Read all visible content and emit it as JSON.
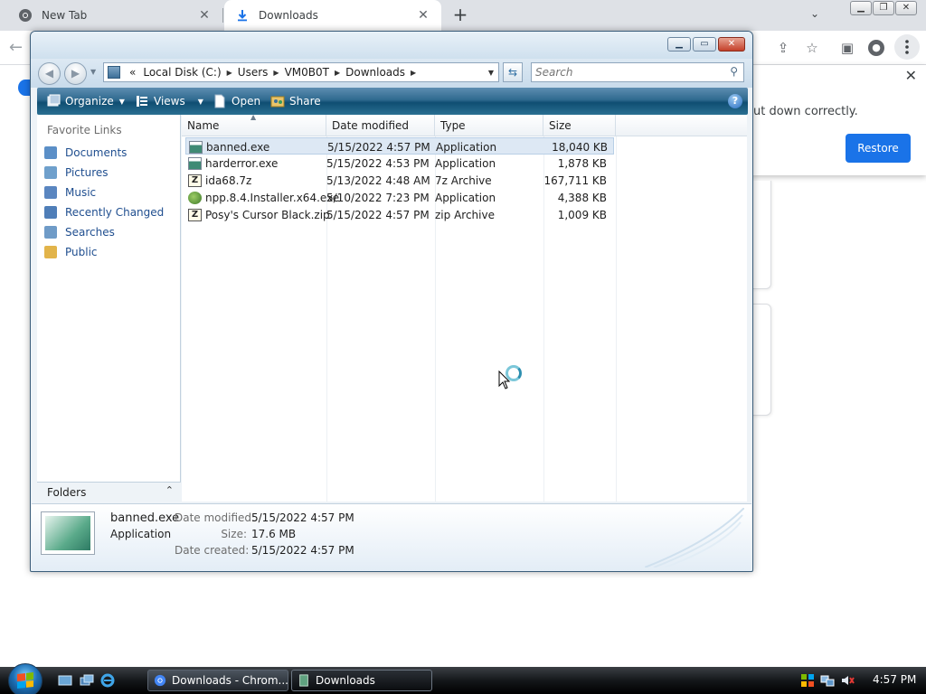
{
  "browser": {
    "tabs": [
      {
        "label": "New Tab",
        "icon": "chrome-icon"
      },
      {
        "label": "Downloads",
        "icon": "download-icon"
      }
    ],
    "new_tab_label": "+",
    "restore_message": "ut down correctly.",
    "restore_button": "Restore"
  },
  "explorer": {
    "breadcrumb": [
      "Local Disk (C:)",
      "Users",
      "VM0B0T",
      "Downloads"
    ],
    "breadcrumb_prefix": "«",
    "search_placeholder": "Search",
    "toolbar": {
      "organize": "Organize",
      "views": "Views",
      "open": "Open",
      "share": "Share",
      "help": "?"
    },
    "favorite_links_header": "Favorite Links",
    "favorite_links": [
      {
        "label": "Documents",
        "icon": "documents-icon",
        "color": "#5b8fc7"
      },
      {
        "label": "Pictures",
        "icon": "pictures-icon",
        "color": "#6fa0cc"
      },
      {
        "label": "Music",
        "icon": "music-icon",
        "color": "#5a86c0"
      },
      {
        "label": "Recently Changed",
        "icon": "recently-changed-icon",
        "color": "#4f7eb8"
      },
      {
        "label": "Searches",
        "icon": "searches-icon",
        "color": "#6f9bc7"
      },
      {
        "label": "Public",
        "icon": "public-folder-icon",
        "color": "#e2b44a"
      }
    ],
    "folders_label": "Folders",
    "columns": [
      "Name",
      "Date modified",
      "Type",
      "Size"
    ],
    "files": [
      {
        "name": "banned.exe",
        "date": "5/15/2022 4:57 PM",
        "type": "Application",
        "size": "18,040 KB",
        "icon": "app",
        "selected": true
      },
      {
        "name": "harderror.exe",
        "date": "5/15/2022 4:53 PM",
        "type": "Application",
        "size": "1,878 KB",
        "icon": "app",
        "selected": false
      },
      {
        "name": "ida68.7z",
        "date": "5/13/2022 4:48 AM",
        "type": "7z Archive",
        "size": "167,711 KB",
        "icon": "zip",
        "selected": false
      },
      {
        "name": "npp.8.4.Installer.x64.exe",
        "date": "5/10/2022 7:23 PM",
        "type": "Application",
        "size": "4,388 KB",
        "icon": "npp",
        "selected": false
      },
      {
        "name": "Posy's Cursor Black.zip",
        "date": "5/15/2022 4:57 PM",
        "type": "zip Archive",
        "size": "1,009 KB",
        "icon": "zip",
        "selected": false
      }
    ],
    "details": {
      "name": "banned.exe",
      "type": "Application",
      "date_modified_label": "Date modified:",
      "date_modified": "5/15/2022 4:57 PM",
      "size_label": "Size:",
      "size": "17.6 MB",
      "date_created_label": "Date created:",
      "date_created": "5/15/2022 4:57 PM"
    }
  },
  "taskbar": {
    "tasks": [
      {
        "label": "Downloads - Chrom...",
        "icon": "chrome-icon"
      },
      {
        "label": "Downloads",
        "icon": "explorer-icon"
      }
    ],
    "clock": "4:57 PM"
  }
}
